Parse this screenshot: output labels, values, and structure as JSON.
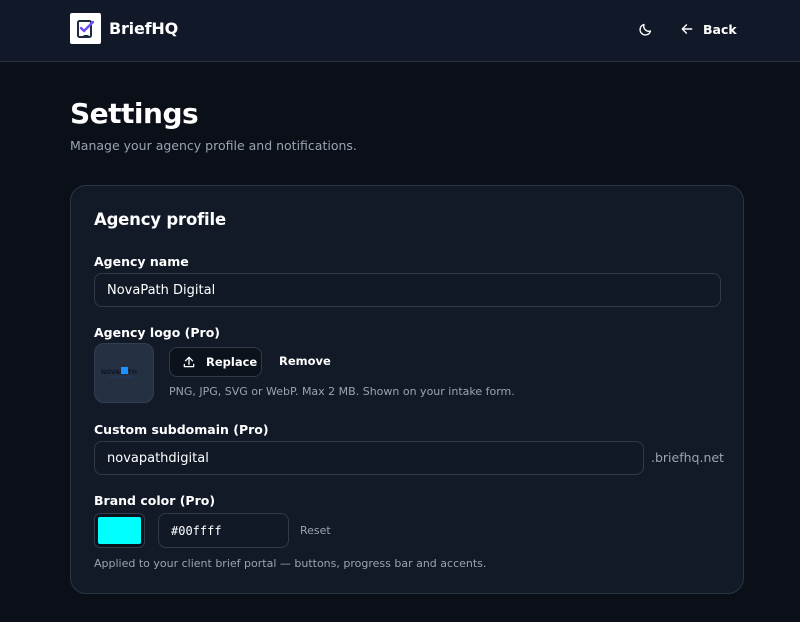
{
  "header": {
    "brand": "BriefHQ",
    "logo_icon": "brief-logo-icon",
    "theme_icon": "moon-icon",
    "back_icon": "arrow-left-icon",
    "back_label": "Back"
  },
  "page": {
    "title": "Settings",
    "subtitle": "Manage your agency profile and notifications."
  },
  "agency_profile": {
    "title": "Agency profile",
    "name_label": "Agency name",
    "name_value": "NovaPath Digital",
    "logo_label": "Agency logo (Pro)",
    "logo_image_text": "NOVAPATH",
    "replace_label": "Replace",
    "upload_icon": "upload-icon",
    "remove_label": "Remove",
    "logo_hint": "PNG, JPG, SVG or WebP. Max 2 MB. Shown on your intake form.",
    "subdomain_label": "Custom subdomain (Pro)",
    "subdomain_value": "novapathdigital",
    "subdomain_suffix": ".briefhq.net",
    "brand_color_label": "Brand color (Pro)",
    "brand_color_value": "#00ffff",
    "reset_label": "Reset",
    "brand_color_hint": "Applied to your client brief portal — buttons, progress bar and accents."
  },
  "colors": {
    "accent": "#00ffff",
    "background": "#0a0f18",
    "card": "#121a27"
  }
}
